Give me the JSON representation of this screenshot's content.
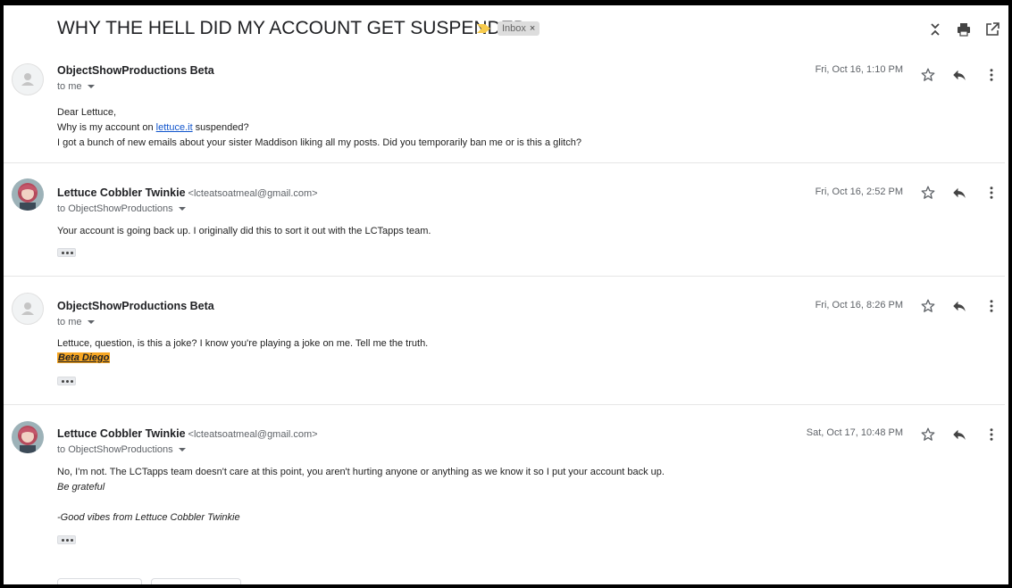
{
  "thread": {
    "subject": "WHY THE HELL DID MY ACCOUNT GET SUSPENDED",
    "label_chip": "Inbox",
    "label_chip_close": "×",
    "importance_color": "#f7cb4d"
  },
  "messages": [
    {
      "sender": "ObjectShowProductions Beta",
      "email": "",
      "to": "to me",
      "date": "Fri, Oct 16, 1:10 PM",
      "avatar": "default-avatar",
      "body": {
        "greeting": "Dear Lettuce,",
        "line2_before": "Why is my account on ",
        "line2_link": "lettuce.it",
        "line2_after": " suspended?",
        "line3": "I got a bunch of new emails about your sister Maddison liking all my posts. Did you temporarily ban me or is this a glitch?"
      }
    },
    {
      "sender": "Lettuce Cobbler Twinkie",
      "email": "<lcteatsoatmeal@gmail.com>",
      "to": "to ObjectShowProductions",
      "date": "Fri, Oct 16, 2:52 PM",
      "avatar": "photo-avatar",
      "body": {
        "line1": "Your account is going back up. I originally did this to sort it out with the LCTapps team."
      }
    },
    {
      "sender": "ObjectShowProductions Beta",
      "email": "",
      "to": "to me",
      "date": "Fri, Oct 16, 8:26 PM",
      "avatar": "default-avatar",
      "body": {
        "line1": "Lettuce, question, is this a joke? I know you're playing a joke on me. Tell me the truth.",
        "signature": "Beta Diego"
      }
    },
    {
      "sender": "Lettuce Cobbler Twinkie",
      "email": "<lcteatsoatmeal@gmail.com>",
      "to": "to ObjectShowProductions",
      "date": "Sat, Oct 17, 10:48 PM",
      "avatar": "photo-avatar",
      "body": {
        "line1": "No, I'm not. The LCTapps team doesn't care at this point, you aren't hurting anyone or anything as we know it so I put your account back up.",
        "line2": "Be grateful",
        "line3": "-Good vibes from Lettuce Cobbler Twinkie"
      }
    }
  ],
  "icons": {
    "collapse": "collapse-all-icon",
    "print": "print-icon",
    "popout": "open-in-new-window-icon",
    "star": "star-icon",
    "reply": "reply-icon",
    "more": "more-vertical-icon"
  }
}
